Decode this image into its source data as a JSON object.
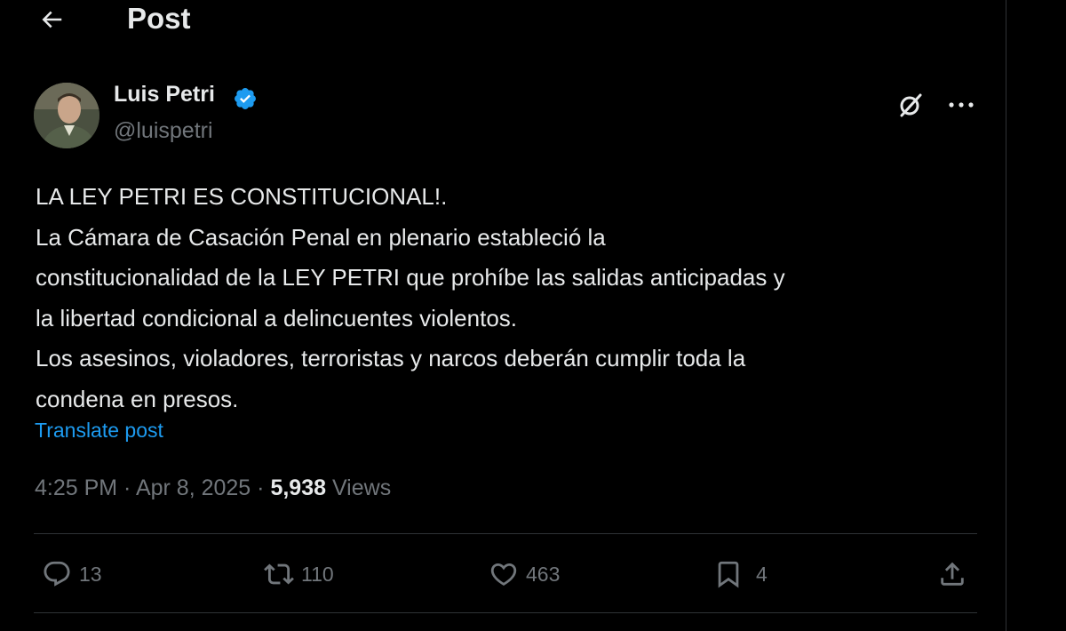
{
  "header": {
    "title": "Post"
  },
  "author": {
    "name": "Luis Petri",
    "handle": "@luispetri"
  },
  "post": {
    "lines": [
      "LA LEY PETRI ES CONSTITUCIONAL!.",
      "La Cámara de Casación Penal en plenario estableció la",
      "constitucionalidad de la LEY PETRI que prohíbe las salidas anticipadas y",
      "la libertad condicional a delincuentes violentos.",
      "Los asesinos, violadores, terroristas y narcos deberán cumplir toda la",
      "condena en presos."
    ],
    "translate_label": "Translate post",
    "time": "4:25 PM",
    "date": "Apr 8, 2025",
    "views_count": "5,938",
    "views_label": "Views"
  },
  "stats": {
    "replies": "13",
    "reposts": "110",
    "likes": "463",
    "bookmarks": "4"
  },
  "icons": {
    "back": "arrow-left-icon",
    "verified": "verified-badge-icon",
    "grok": "grok-icon",
    "more": "more-horizontal-icon",
    "reply": "reply-icon",
    "repost": "repost-icon",
    "like": "heart-icon",
    "bookmark": "bookmark-icon",
    "share": "share-icon"
  },
  "colors": {
    "background": "#000000",
    "text": "#e7e9ea",
    "muted": "#71767b",
    "accent": "#1d9bf0"
  }
}
